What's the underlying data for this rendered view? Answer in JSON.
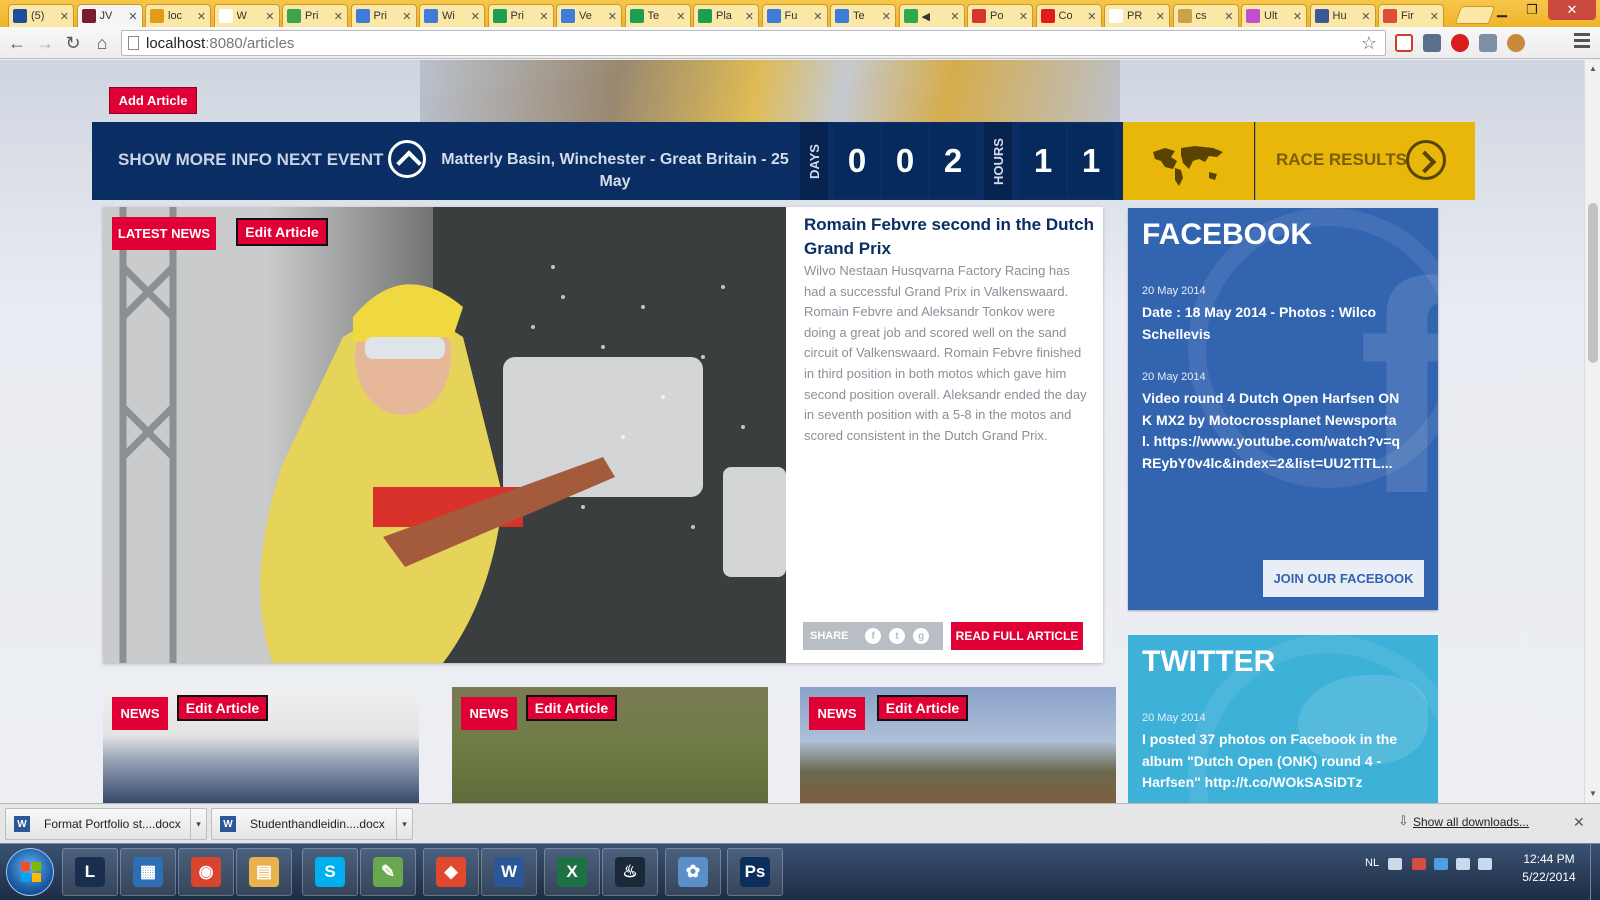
{
  "browser": {
    "tabs": [
      {
        "label": "(5)",
        "color": "#1e4f9c"
      },
      {
        "label": "JV",
        "color": "#7a1b2c",
        "active": true
      },
      {
        "label": "loc",
        "color": "#e39a17"
      },
      {
        "label": "W",
        "color": "#ffffff"
      },
      {
        "label": "Pri",
        "color": "#3fa34d"
      },
      {
        "label": "Pri",
        "color": "#3f7bd8"
      },
      {
        "label": "Wi",
        "color": "#3f7bd8"
      },
      {
        "label": "Pri",
        "color": "#1b9e4f"
      },
      {
        "label": "Ve",
        "color": "#3f7bd8"
      },
      {
        "label": "Te",
        "color": "#1b9e4f"
      },
      {
        "label": "Pla",
        "color": "#1b9e4f"
      },
      {
        "label": "Fu",
        "color": "#3f7bd8"
      },
      {
        "label": "Te",
        "color": "#3f7bd8"
      },
      {
        "label": "◀",
        "color": "#2ea84f"
      },
      {
        "label": "Po",
        "color": "#d6362b"
      },
      {
        "label": "Co",
        "color": "#e11b1b"
      },
      {
        "label": "PR",
        "color": "#ffffff"
      },
      {
        "label": "cs",
        "color": "#c7a24a"
      },
      {
        "label": "Ult",
        "color": "#c04fd0"
      },
      {
        "label": "Hu",
        "color": "#3b5998"
      },
      {
        "label": "Fir",
        "color": "#dd4b39"
      }
    ],
    "url_host": "localhost",
    "url_rest": ":8080/articles"
  },
  "page": {
    "add_article": "Add Article",
    "event": {
      "show_more": "SHOW MORE INFO NEXT EVENT",
      "name": "Matterly Basin, Winchester - Great Britain - 25 May",
      "days_label": "DAYS",
      "days_digits": [
        "0",
        "0",
        "2"
      ],
      "hours_label": "HOURS",
      "hours_digits": [
        "1",
        "1"
      ],
      "race_results": "RACE RESULTS"
    },
    "featured": {
      "tag": "LATEST NEWS",
      "edit": "Edit Article",
      "title": "Romain Febvre second in the Dutch Grand Prix",
      "body": "Wilvo Nestaan Husqvarna Factory Racing has had a successful Grand Prix in Valkenswaard. Romain Febvre and Aleksandr Tonkov were doing a great job and scored well on the sand circuit of Valkenswaard. Romain Febvre finished in third position in both motos which gave him second position overall. Aleksandr ended the day in seventh position with a 5-8 in the motos and scored consistent in the Dutch Grand Prix.",
      "share": "SHARE",
      "read_full": "READ FULL ARTICLE"
    },
    "facebook": {
      "title": "FACEBOOK",
      "posts": [
        {
          "date": "20 May 2014",
          "text": "Date : 18 May 2014 - Photos : Wilco Schellevis"
        },
        {
          "date": "20 May 2014",
          "text": "Video round 4 Dutch Open Harfsen ONK MX2 by Motocrossplanet Newsportal. https://www.youtube.com/watch?v=qREybY0v4lc&index=2&list=UU2TlTL..."
        }
      ],
      "join": "JOIN OUR FACEBOOK"
    },
    "twitter": {
      "title": "TWITTER",
      "posts": [
        {
          "date": "20 May 2014",
          "text": "I posted 37 photos on Facebook in the album \"Dutch Open (ONK) round 4 - Harfsen\" http://t.co/WOkSASiDTz"
        }
      ]
    },
    "cards": [
      {
        "tag": "NEWS",
        "edit": "Edit Article"
      },
      {
        "tag": "NEWS",
        "edit": "Edit Article"
      },
      {
        "tag": "NEWS",
        "edit": "Edit Article"
      }
    ]
  },
  "downloads": {
    "items": [
      "Format Portfolio st....docx",
      "Studenthandleidin....docx"
    ],
    "show_all": "Show all downloads..."
  },
  "taskbar": {
    "apps": [
      {
        "name": "league-of-legends",
        "glyph": "L",
        "color": "#1a2f4f"
      },
      {
        "name": "metro-apps",
        "glyph": "▦",
        "color": "#2f6eb5"
      },
      {
        "name": "chrome",
        "glyph": "◉",
        "color": "#d9442f"
      },
      {
        "name": "explorer",
        "glyph": "▤",
        "color": "#e8b24c"
      },
      {
        "name": "skype",
        "glyph": "S",
        "color": "#00aff0"
      },
      {
        "name": "notepad",
        "glyph": "✎",
        "color": "#6aa84f"
      },
      {
        "name": "git",
        "glyph": "◆",
        "color": "#e0492e"
      },
      {
        "name": "word",
        "glyph": "W",
        "color": "#2b5797"
      },
      {
        "name": "excel",
        "glyph": "X",
        "color": "#1e7145"
      },
      {
        "name": "steam",
        "glyph": "♨",
        "color": "#1b2838"
      },
      {
        "name": "paint",
        "glyph": "✿",
        "color": "#5a8fc7"
      },
      {
        "name": "photoshop",
        "glyph": "Ps",
        "color": "#0b2f5a"
      }
    ],
    "lang": "NL",
    "time": "12:44 PM",
    "date": "5/22/2014"
  }
}
